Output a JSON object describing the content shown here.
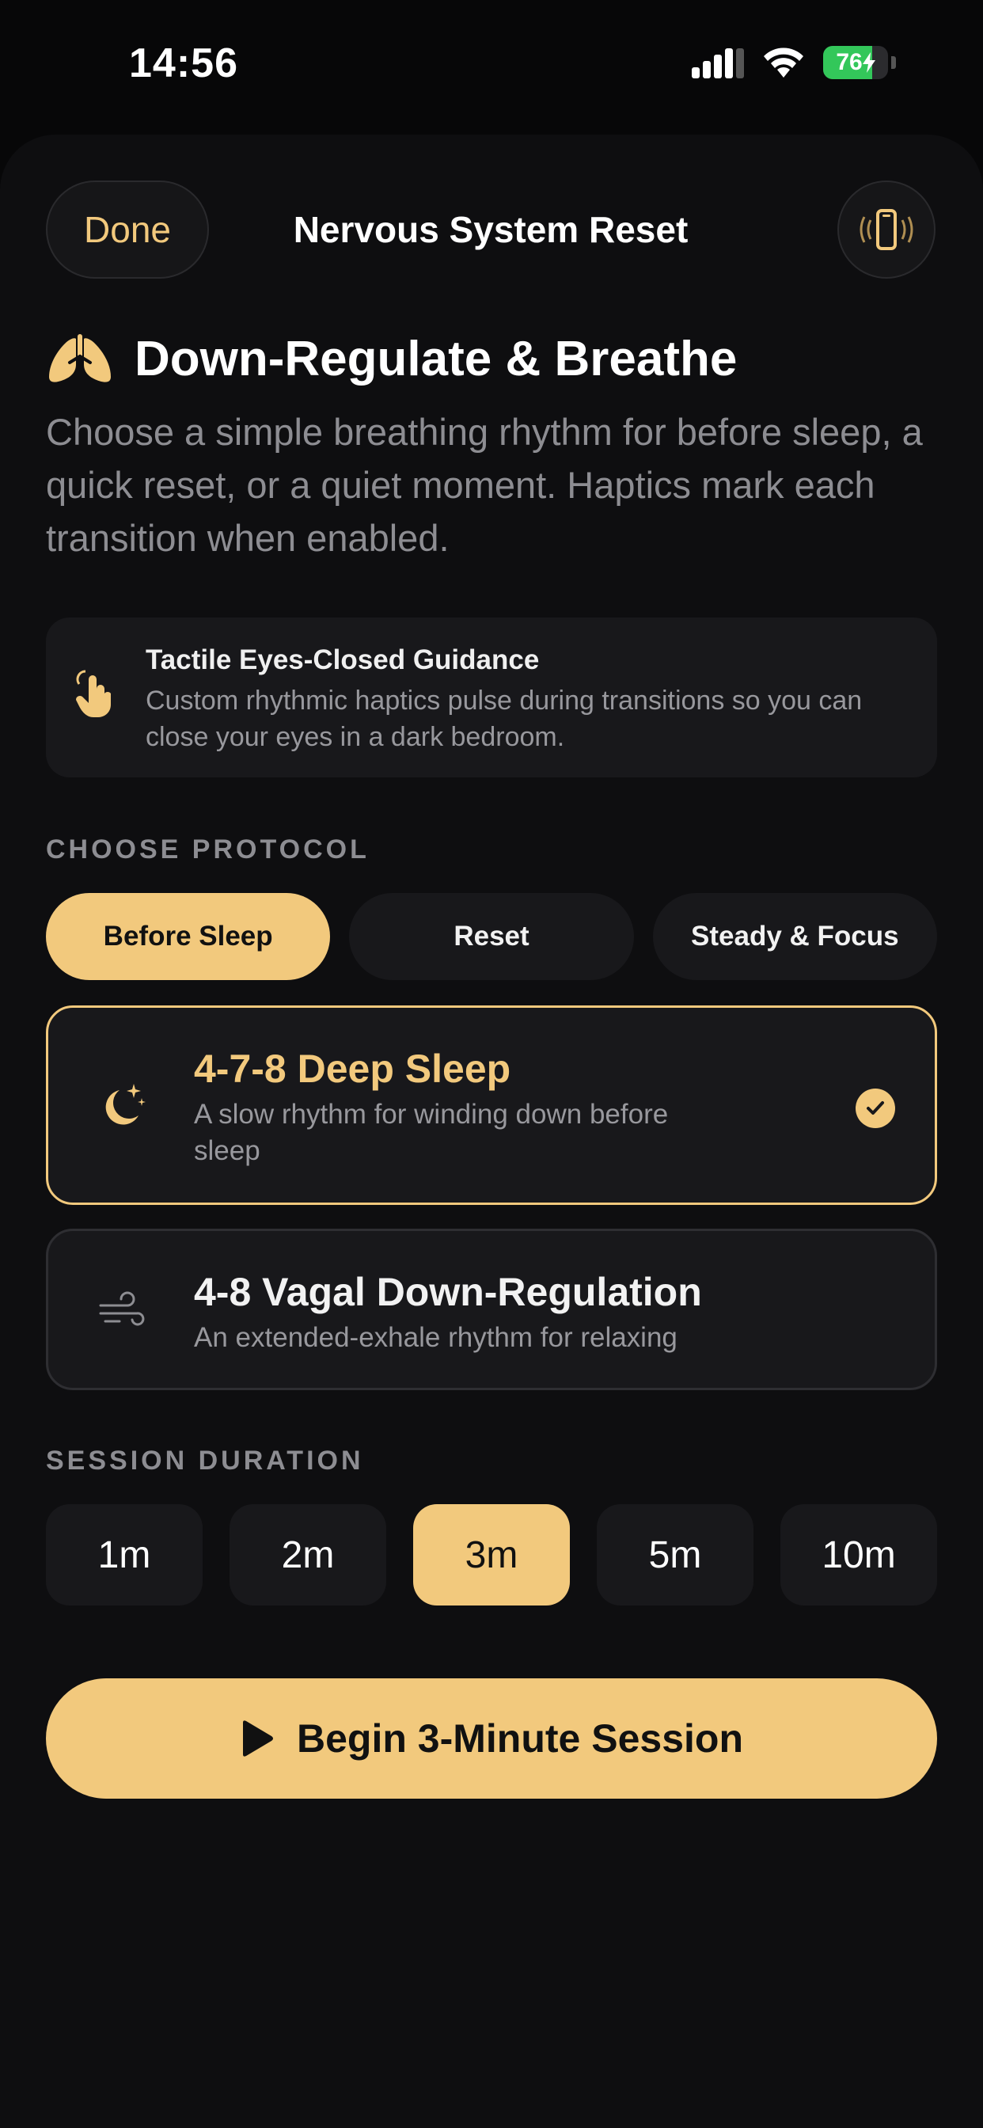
{
  "status_bar": {
    "time": "14:56",
    "battery_level": "76",
    "battery_fraction": 0.76
  },
  "nav": {
    "done_label": "Done",
    "title": "Nervous System Reset",
    "haptic_icon": "phone-vibrate-icon"
  },
  "header": {
    "icon": "lungs-icon",
    "title": "Down-Regulate & Breathe",
    "subtitle": "Choose a simple breathing rhythm for before sleep, a quick reset, or a quiet moment. Haptics mark each transition when enabled."
  },
  "guidance": {
    "icon": "hand-tap-icon",
    "title": "Tactile Eyes-Closed Guidance",
    "description": "Custom rhythmic haptics pulse during transitions so you can close your eyes in a dark bedroom."
  },
  "protocol_section": {
    "label": "CHOOSE PROTOCOL",
    "tabs": [
      "Before Sleep",
      "Reset",
      "Steady & Focus"
    ],
    "selected_tab": "Before Sleep"
  },
  "protocols": [
    {
      "icon": "moon-stars-icon",
      "title": "4-7-8 Deep Sleep",
      "description": "A slow rhythm for winding down before sleep",
      "selected": true
    },
    {
      "icon": "wind-icon",
      "title": "4-8 Vagal Down-Regulation",
      "description": "An extended-exhale rhythm for relaxing",
      "selected": false
    }
  ],
  "duration_section": {
    "label": "SESSION DURATION",
    "options": [
      "1m",
      "2m",
      "3m",
      "5m",
      "10m"
    ],
    "selected": "3m"
  },
  "begin_button": {
    "icon": "play-icon",
    "label": "Begin 3-Minute Session"
  },
  "colors": {
    "accent": "#f2c97d",
    "background": "#0e0e10",
    "card": "#18181b",
    "battery_green": "#33c75a"
  }
}
